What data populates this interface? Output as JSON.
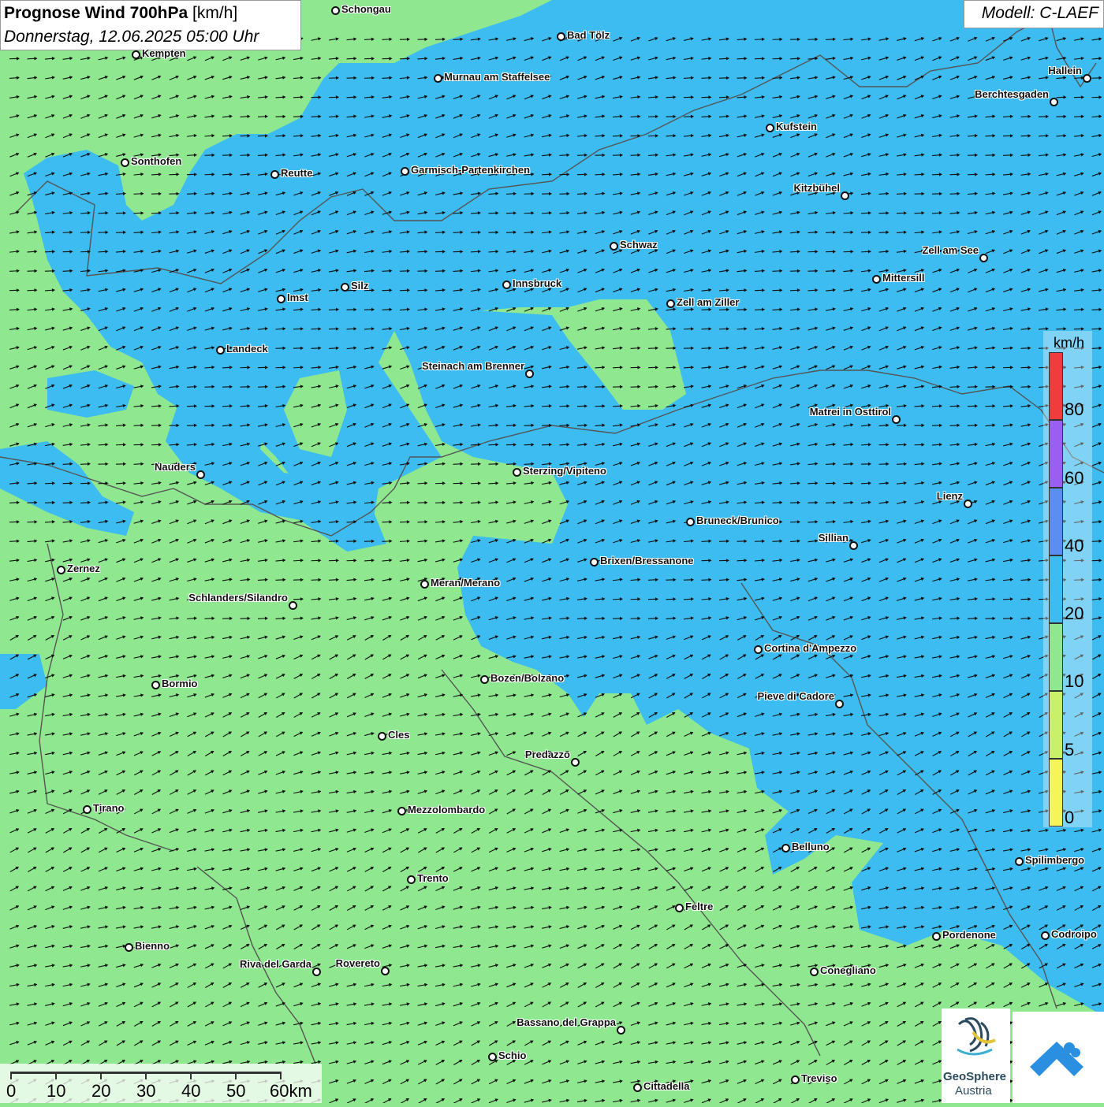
{
  "header": {
    "title_bold": "Prognose Wind 700hPa",
    "title_unit": "[km/h]",
    "date": "Donnerstag, 12.06.2025 05:00 Uhr",
    "model": "Modell: C-LAEF"
  },
  "legend": {
    "unit": "km/h",
    "levels": [
      {
        "label": "0",
        "color": "#f5f55a"
      },
      {
        "label": "5",
        "color": "#c8f06a"
      },
      {
        "label": "10",
        "color": "#8fe88f"
      },
      {
        "label": "20",
        "color": "#3cbcf0"
      },
      {
        "label": "40",
        "color": "#5a8ef0"
      },
      {
        "label": "60",
        "color": "#9a5ef0"
      },
      {
        "label": "80",
        "color": "#f03c3c"
      }
    ]
  },
  "scale_bar": {
    "labels": [
      "0",
      "10",
      "20",
      "30",
      "40",
      "50",
      "60km"
    ]
  },
  "cities": [
    {
      "name": "Schongau"
    },
    {
      "name": "Bad Tölz"
    },
    {
      "name": "Kempten"
    },
    {
      "name": "Murnau am Staffelsee"
    },
    {
      "name": "Hallein"
    },
    {
      "name": "Berchtesgaden"
    },
    {
      "name": "Kufstein"
    },
    {
      "name": "Sonthofen"
    },
    {
      "name": "Reutte"
    },
    {
      "name": "Garmisch-Partenkirchen"
    },
    {
      "name": "Kitzbühel"
    },
    {
      "name": "Schwaz"
    },
    {
      "name": "Zell am See"
    },
    {
      "name": "Mittersill"
    },
    {
      "name": "Innsbruck"
    },
    {
      "name": "Silz"
    },
    {
      "name": "Imst"
    },
    {
      "name": "Zell am Ziller"
    },
    {
      "name": "Landeck"
    },
    {
      "name": "Steinach am Brenner"
    },
    {
      "name": "Matrei in Osttirol"
    },
    {
      "name": "Nauders"
    },
    {
      "name": "Sterzing/Vipiteno"
    },
    {
      "name": "Lienz"
    },
    {
      "name": "Bruneck/Brunico"
    },
    {
      "name": "Sillian"
    },
    {
      "name": "Zernez"
    },
    {
      "name": "Brixen/Bressanone"
    },
    {
      "name": "Meran/Merano"
    },
    {
      "name": "Schlanders/Silandro"
    },
    {
      "name": "Cortina d'Ampezzo"
    },
    {
      "name": "Bozen/Bolzano"
    },
    {
      "name": "Bormio"
    },
    {
      "name": "Pieve di Cadore"
    },
    {
      "name": "Cles"
    },
    {
      "name": "Predazzo"
    },
    {
      "name": "Tirano"
    },
    {
      "name": "Mezzolombardo"
    },
    {
      "name": "Belluno"
    },
    {
      "name": "Spilimbergo"
    },
    {
      "name": "Trento"
    },
    {
      "name": "Feltre"
    },
    {
      "name": "Pordenone"
    },
    {
      "name": "Codroipo"
    },
    {
      "name": "Bienno"
    },
    {
      "name": "Riva del Garda"
    },
    {
      "name": "Rovereto"
    },
    {
      "name": "Conegliano"
    },
    {
      "name": "Bassano del Grappa"
    },
    {
      "name": "Schio"
    },
    {
      "name": "Treviso"
    },
    {
      "name": "Cittadella"
    }
  ],
  "branding": {
    "logo_line1": "GeoSphere",
    "logo_line2": "Austria"
  }
}
